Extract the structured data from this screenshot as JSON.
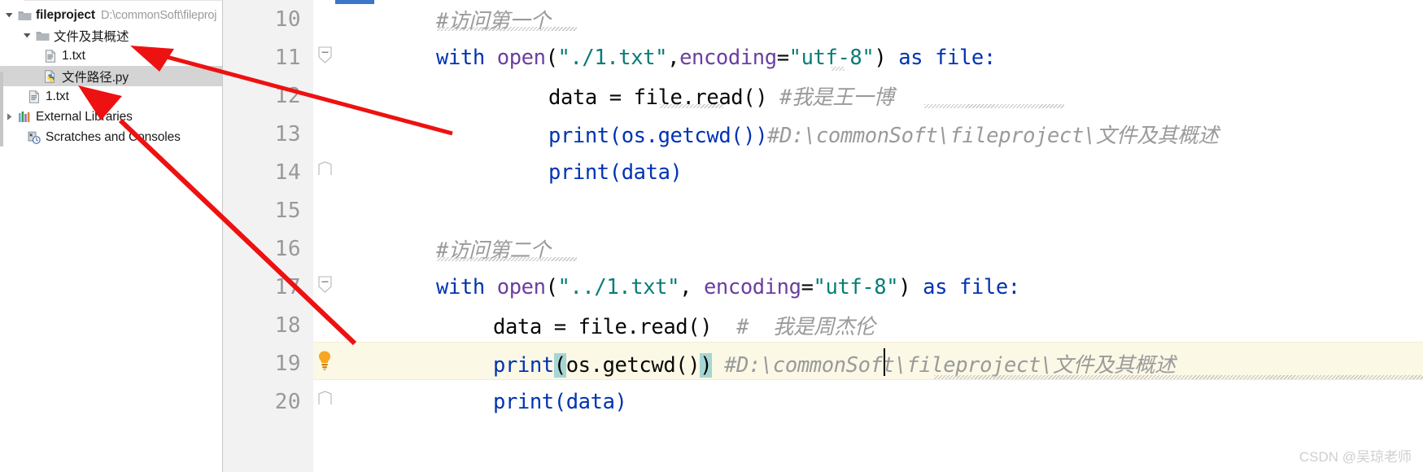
{
  "project_tree": {
    "nodes": [
      {
        "label": "fileproject",
        "path": "D:\\commonSoft\\fileproj",
        "icon": "folder-icon",
        "twisty": "expanded",
        "indent": 1,
        "bold": true,
        "selected": false
      },
      {
        "label": "文件及其概述",
        "path": "",
        "icon": "folder-icon",
        "twisty": "expanded",
        "indent": 2,
        "bold": false,
        "selected": false
      },
      {
        "label": "1.txt",
        "path": "",
        "icon": "text-file-icon",
        "twisty": "none",
        "indent": 3,
        "bold": false,
        "selected": false
      },
      {
        "label": "文件路径.py",
        "path": "",
        "icon": "python-file-icon",
        "twisty": "none",
        "indent": 3,
        "bold": false,
        "selected": true
      },
      {
        "label": "1.txt",
        "path": "",
        "icon": "text-file-icon",
        "twisty": "none",
        "indent": 4,
        "bold": false,
        "selected": false
      },
      {
        "label": "External Libraries",
        "path": "",
        "icon": "libraries-icon",
        "twisty": "collapsed",
        "indent": 1,
        "bold": false,
        "selected": false
      },
      {
        "label": "Scratches and Consoles",
        "path": "",
        "icon": "scratches-icon",
        "twisty": "none",
        "indent": 4,
        "bold": false,
        "selected": false
      }
    ]
  },
  "editor": {
    "active_line": 19,
    "lines": [
      {
        "num": "10",
        "fold": "none",
        "lamp": false,
        "highlight": false
      },
      {
        "num": "11",
        "fold": "open",
        "lamp": false,
        "highlight": false
      },
      {
        "num": "12",
        "fold": "none",
        "lamp": false,
        "highlight": false
      },
      {
        "num": "13",
        "fold": "none",
        "lamp": false,
        "highlight": false
      },
      {
        "num": "14",
        "fold": "end",
        "lamp": false,
        "highlight": false
      },
      {
        "num": "15",
        "fold": "none",
        "lamp": false,
        "highlight": false
      },
      {
        "num": "16",
        "fold": "none",
        "lamp": false,
        "highlight": false
      },
      {
        "num": "17",
        "fold": "open",
        "lamp": false,
        "highlight": false
      },
      {
        "num": "18",
        "fold": "none",
        "lamp": false,
        "highlight": false
      },
      {
        "num": "19",
        "fold": "none",
        "lamp": true,
        "highlight": true
      },
      {
        "num": "20",
        "fold": "end",
        "lamp": false,
        "highlight": false
      }
    ],
    "code": {
      "l10_comment": "#访问第一个",
      "l11_kw_with": "with",
      "l11_fn_open": "open",
      "l11_str_path": "\"./1.txt\"",
      "l11_comma": ",",
      "l11_kwarg": "encoding",
      "l11_eq": "=",
      "l11_str_enc": "\"utf-8\"",
      "l11_close": ")",
      "l11_kw_as": "as",
      "l11_var": "file:",
      "l12_code": "data = file.read()",
      "l12_comment": "#我是王一博",
      "l13_code": "print(os.getcwd())",
      "l13_comment": "#D:\\commonSoft\\fileproject\\文件及其概述",
      "l14_code": "print(data)",
      "l16_comment": "#访问第二个",
      "l17_kw_with": "with",
      "l17_fn_open": "open",
      "l17_str_path": "\"../1.txt\"",
      "l17_comma": ",",
      "l17_kwarg": "encoding",
      "l17_eq": "=",
      "l17_str_enc": "\"utf-8\"",
      "l17_close": ")",
      "l17_kw_as": "as",
      "l17_var": "file:",
      "l18_code": "data = file.read()",
      "l18_comment": "#  我是周杰伦",
      "l19_print": "print",
      "l19_open_paren": "(",
      "l19_inner": "os.getcwd()",
      "l19_close_paren": ")",
      "l19_comment": "#D:\\commonSoft\\fileproject\\文件及其概述",
      "l20_code": "print(data)"
    }
  },
  "annotations": {
    "arrow_1": "red-arrow-to-1txt",
    "arrow_2": "red-arrow-to-1txt-outer"
  },
  "watermark": {
    "text": "CSDN @吴琼老师"
  },
  "colors": {
    "keyword": "#0033b3",
    "function": "#6b3fa0",
    "string": "#067d76",
    "comment": "#9a9a9a",
    "highlight_row": "#fbf8e6",
    "bracket_match": "#a5d6d3",
    "arrow_red": "#ee1111",
    "tab_indicator": "#3c76c8",
    "selection": "#d4d4d4"
  }
}
